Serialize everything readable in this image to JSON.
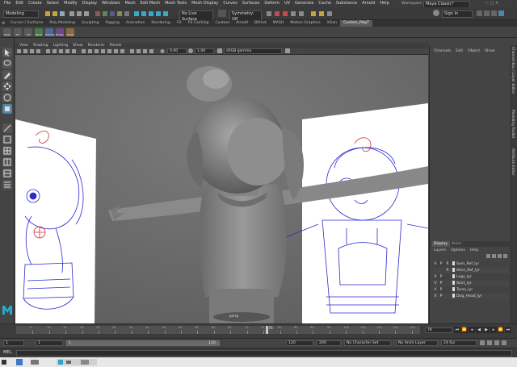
{
  "menubar": {
    "items": [
      "File",
      "Edit",
      "Create",
      "Select",
      "Modify",
      "Display",
      "Windows",
      "Mesh",
      "Edit Mesh",
      "Mesh Tools",
      "Mesh Display",
      "Curves",
      "Surfaces",
      "Deform",
      "UV",
      "Generate",
      "Cache",
      "Substance",
      "Arnold",
      "Help"
    ],
    "workspace_label": "Workspace :",
    "workspace_value": "Maya Classic*"
  },
  "statusline": {
    "mode": "Modeling",
    "live_surface": "No Live Surface",
    "symmetry": "Symmetry: Off",
    "sign_in": "Sign In"
  },
  "shelf": {
    "tabs": [
      "Curves / Surfaces",
      "Poly Modeling",
      "Sculpting",
      "Rigging",
      "Animation",
      "Rendering",
      "FX",
      "FX Caching",
      "Custom",
      "Arnold",
      "Bifrost",
      "MASH",
      "Motion Graphics",
      "XGen",
      "Custom_PolyT"
    ],
    "active_tab": "Custom_PolyT",
    "buttons": [
      "Mesh",
      "PT",
      "CP",
      "Bevel",
      "Extrude",
      "Bridge",
      "Merge"
    ]
  },
  "viewport": {
    "menu": [
      "View",
      "Shading",
      "Lighting",
      "Show",
      "Renderer",
      "Panels"
    ],
    "exposure": "0.00",
    "gamma": "1.00",
    "colorspace": "sRGB gamma",
    "camera_label": "persp"
  },
  "rightpanel": {
    "channel_menu": [
      "Channels",
      "Edit",
      "Object",
      "Show"
    ],
    "display_tabs": [
      "Display",
      "Anim"
    ],
    "layer_menu": [
      "Layers",
      "Options",
      "Help"
    ],
    "layers": [
      {
        "v": "V",
        "p": "P",
        "r": "R",
        "name": "Sam_Ref_lyr"
      },
      {
        "v": "",
        "p": "",
        "r": "R",
        "name": "Alice_Ref_lyr"
      },
      {
        "v": "V",
        "p": "P",
        "r": "",
        "name": "Legs_lyr"
      },
      {
        "v": "V",
        "p": "P",
        "r": "",
        "name": "Skirt_lyr"
      },
      {
        "v": "V",
        "p": "P",
        "r": "",
        "name": "Torso_lyr"
      },
      {
        "v": "V",
        "p": "P",
        "r": "",
        "name": "Dog_Head_lyr"
      }
    ],
    "vertical_tabs": [
      "Channel Box / Layer Editor",
      "Modeling Toolkit",
      "Attribute Editor"
    ]
  },
  "timeline": {
    "ticks": [
      "5",
      "10",
      "15",
      "20",
      "25",
      "30",
      "35",
      "40",
      "45",
      "50",
      "55",
      "60",
      "65",
      "70",
      "75",
      "80",
      "85",
      "90",
      "95",
      "100",
      "105",
      "110",
      "115",
      "120"
    ],
    "current_frame": "76",
    "current_frame_field": "76"
  },
  "range": {
    "start": "1",
    "start2": "1",
    "range_start": "1",
    "range_end": "120",
    "end": "120",
    "end2": "200",
    "character_set": "No Character Set",
    "anim_layer": "No Anim Layer",
    "fps": "24 fps"
  },
  "cmdline": {
    "label": "MEL"
  },
  "colors": {
    "accent": "#5285a6",
    "viewport_bg": "#6a6a6a",
    "sketch_blue": "#2a2ad0",
    "sketch_red": "#c83030"
  }
}
